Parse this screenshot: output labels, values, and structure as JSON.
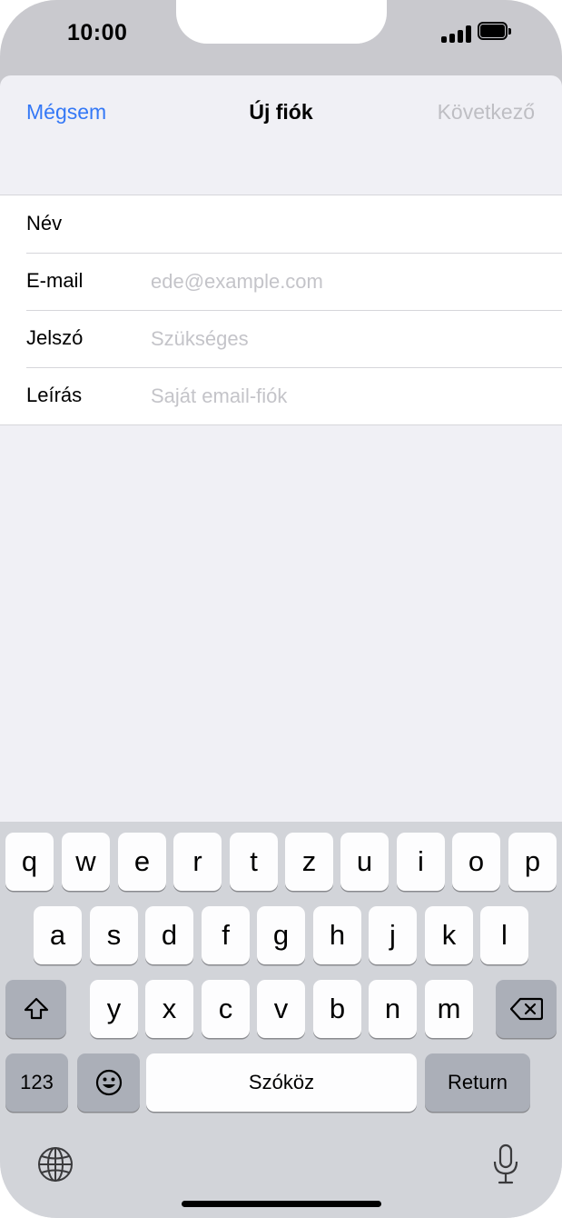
{
  "status_bar": {
    "time": "10:00"
  },
  "nav": {
    "cancel": "Mégsem",
    "title": "Új fiók",
    "next": "Következő"
  },
  "form": [
    {
      "label": "Név",
      "placeholder": ""
    },
    {
      "label": "E-mail",
      "placeholder": "ede@example.com"
    },
    {
      "label": "Jelszó",
      "placeholder": "Szükséges"
    },
    {
      "label": "Leírás",
      "placeholder": "Saját email-fiók"
    }
  ],
  "keyboard": {
    "row1": [
      "q",
      "w",
      "e",
      "r",
      "t",
      "z",
      "u",
      "i",
      "o",
      "p"
    ],
    "row2": [
      "a",
      "s",
      "d",
      "f",
      "g",
      "h",
      "j",
      "k",
      "l"
    ],
    "row3": [
      "y",
      "x",
      "c",
      "v",
      "b",
      "n",
      "m"
    ],
    "numbers": "123",
    "space": "Szóköz",
    "return": "Return"
  },
  "colors": {
    "accent": "#3478f6",
    "disabled": "#bebec3",
    "keyboard_bg": "#d2d4d9"
  },
  "icons": [
    "signal-icon",
    "battery-icon",
    "shift-icon",
    "backspace-icon",
    "emoji-icon",
    "globe-icon",
    "microphone-icon"
  ]
}
